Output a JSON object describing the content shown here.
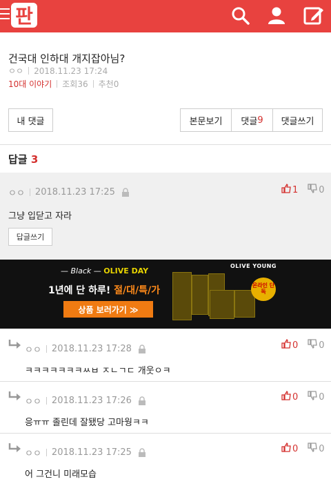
{
  "header": {
    "menu_icon": "hamburger-menu-icon",
    "logo_text": "판",
    "search_icon": "search-icon",
    "user_icon": "user-icon",
    "write_icon": "write-icon",
    "bg_color": "#e8423f"
  },
  "post": {
    "title": "건국대 인하대 개지잡아님?",
    "author": "ㅇㅇ",
    "datetime": "2018.11.23 17:24",
    "category": "10대 이야기",
    "views": "조회36",
    "recommend": "추천0"
  },
  "actions": {
    "my_comments": "내 댓글",
    "view_post": "본문보기",
    "comments_label": "댓글",
    "comments_count": "9",
    "write_comment": "댓글쓰기"
  },
  "replies": {
    "label": "답글",
    "count": "3"
  },
  "comment": {
    "author": "ㅇㅇ",
    "datetime": "2018.11.23 17:25",
    "text": "그냥 입닫고 자라",
    "up": "1",
    "down": "0",
    "reply_button": "답글쓰기"
  },
  "ad": {
    "brand": "OLIVE YOUNG",
    "headline_pre": "Black",
    "headline": "OLIVE DAY",
    "line2_pre": "1년에 단 하루!",
    "line2_hl": "절/대/특/가",
    "button": "상품 보러가기 ≫",
    "badge": "온라인 단독"
  },
  "sub_replies": [
    {
      "author": "ㅇㅇ",
      "datetime": "2018.11.23 17:28",
      "text": "ㅋㅋㅋㅋㅋㅋㅋㅆㅂ ㅈㄴㄱㄷ 개웃ㅇㅋ",
      "up": "0",
      "down": "0"
    },
    {
      "author": "ㅇㅇ",
      "datetime": "2018.11.23 17:26",
      "text": "응ㅠㅠ 졸린데 잘됐당 고마웡ㅋㅋ",
      "up": "0",
      "down": "0"
    },
    {
      "author": "ㅇㅇ",
      "datetime": "2018.11.23 17:25",
      "text": "어 그건니 미래모습",
      "up": "0",
      "down": "0"
    }
  ]
}
